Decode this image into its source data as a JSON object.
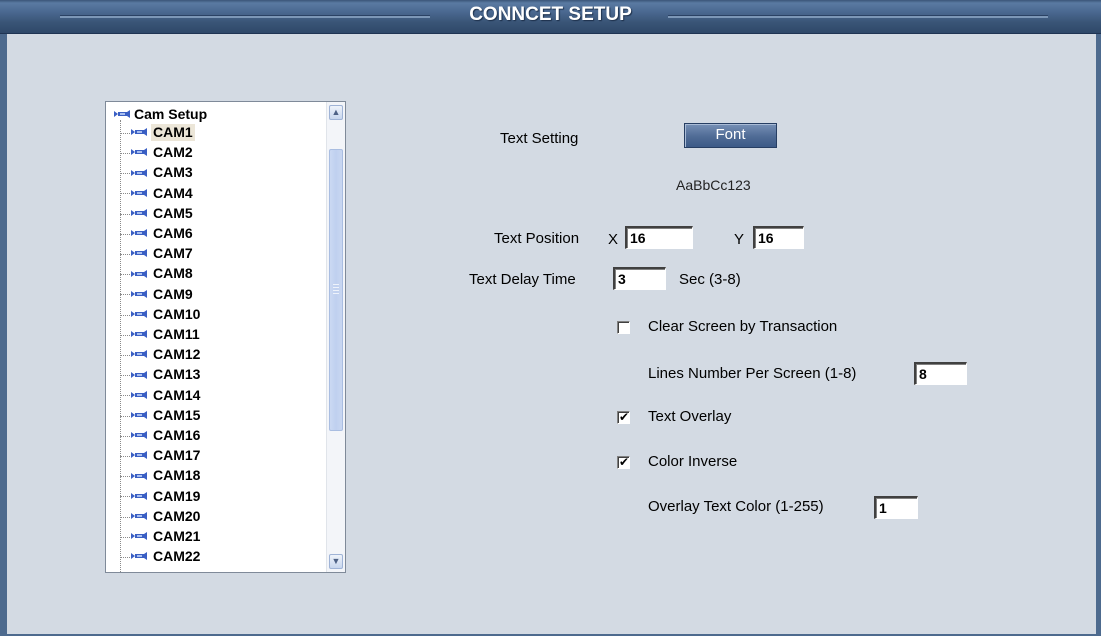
{
  "window": {
    "title": "CONNCET SETUP"
  },
  "tree": {
    "root_label": "Cam Setup",
    "selected": "CAM1",
    "items": [
      "CAM1",
      "CAM2",
      "CAM3",
      "CAM4",
      "CAM5",
      "CAM6",
      "CAM7",
      "CAM8",
      "CAM9",
      "CAM10",
      "CAM11",
      "CAM12",
      "CAM13",
      "CAM14",
      "CAM15",
      "CAM16",
      "CAM17",
      "CAM18",
      "CAM19",
      "CAM20",
      "CAM21",
      "CAM22"
    ],
    "scroll_up_icon": "chevron-up-icon",
    "scroll_down_icon": "chevron-down-icon"
  },
  "settings": {
    "text_setting_label": "Text Setting",
    "font_button": "Font",
    "sample_text": "AaBbCc123",
    "text_position_label": "Text Position",
    "x_label": "X",
    "x_value": "16",
    "y_label": "Y",
    "y_value": "16",
    "delay_label": "Text Delay Time",
    "delay_value": "3",
    "delay_unit": "Sec (3-8)",
    "clear_screen_label": "Clear Screen by Transaction",
    "clear_screen_checked": false,
    "lines_label": "Lines Number Per Screen (1-8)",
    "lines_value": "8",
    "text_overlay_label": "Text Overlay",
    "text_overlay_checked": true,
    "color_inverse_label": "Color Inverse",
    "color_inverse_checked": true,
    "overlay_color_label": "Overlay Text Color (1-255)",
    "overlay_color_value": "1"
  },
  "colors": {
    "title_bar": "#4a6890",
    "background": "#d3dae3",
    "button": "#4f6b95"
  }
}
